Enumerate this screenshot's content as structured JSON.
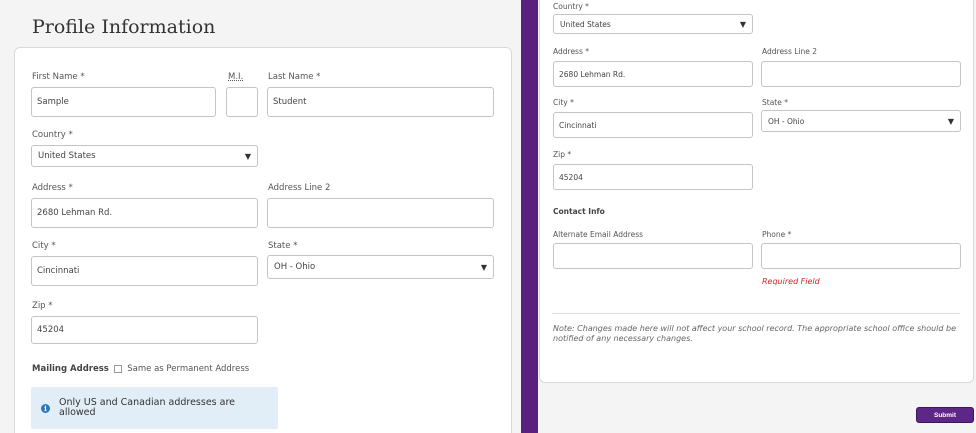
{
  "left_panel": {
    "page_title": "Profile Information",
    "first_name": {
      "label": "First Name *",
      "value": "Sample"
    },
    "middle_initial": {
      "label": "M.I.",
      "value": ""
    },
    "last_name": {
      "label": "Last Name *",
      "value": "Student"
    },
    "country": {
      "label": "Country *",
      "value": "United States"
    },
    "address": {
      "label": "Address *",
      "value": "2680 Lehman Rd."
    },
    "address2": {
      "label": "Address Line 2",
      "value": ""
    },
    "city": {
      "label": "City *",
      "value": "Cincinnati"
    },
    "state": {
      "label": "State *",
      "value": "OH - Ohio"
    },
    "zip": {
      "label": "Zip *",
      "value": "45204"
    },
    "mailing": {
      "label": "Mailing Address",
      "checkbox_label": "Same as Permanent Address"
    },
    "info_text": "Only US and Canadian addresses are allowed"
  },
  "right_panel": {
    "country": {
      "label": "Country *",
      "value": "United States"
    },
    "address": {
      "label": "Address *",
      "value": "2680 Lehman Rd."
    },
    "address2": {
      "label": "Address Line 2",
      "value": ""
    },
    "city": {
      "label": "City *",
      "value": "Cincinnati"
    },
    "state": {
      "label": "State *",
      "value": "OH - Ohio"
    },
    "zip": {
      "label": "Zip *",
      "value": "45204"
    },
    "contact_heading": "Contact Info",
    "alt_email": {
      "label": "Alternate Email Address",
      "value": ""
    },
    "phone": {
      "label": "Phone *",
      "value": "",
      "error": "Required Field"
    },
    "note": "Note: Changes made here will not affect your school record. The appropriate school office should be notified of any necessary changes.",
    "submit_label": "Submit"
  },
  "icons": {
    "dropdown": "▼",
    "info": "i"
  },
  "colors": {
    "brand_purple": "#5b1f7d",
    "error_red": "#d9262a",
    "info_blue": "#2f78b7",
    "info_bg": "#e1eef8"
  }
}
